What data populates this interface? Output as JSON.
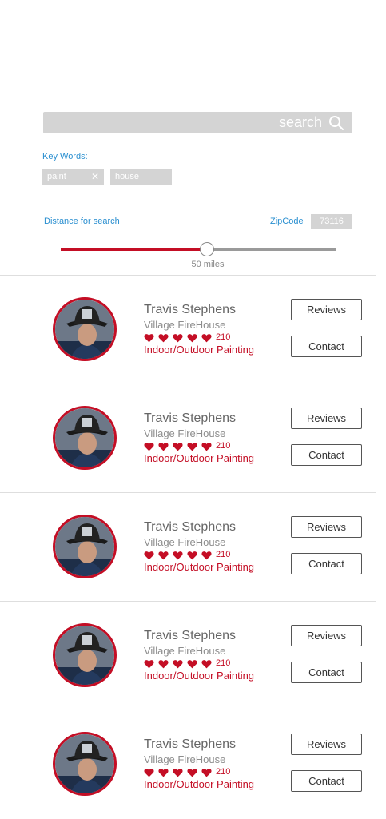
{
  "search": {
    "placeholder": "search"
  },
  "keywords": {
    "label": "Key Words:",
    "tags": [
      {
        "text": "paint",
        "removable": true
      },
      {
        "text": "house",
        "removable": false
      }
    ]
  },
  "distance": {
    "label": "Distance for search",
    "value_text": "50 miles",
    "slider_fraction": 0.53
  },
  "zip": {
    "label": "ZipCode",
    "value": "73116"
  },
  "colors": {
    "accent": "#c40e25",
    "link": "#2a8fd0",
    "field": "#d4d4d4"
  },
  "results": [
    {
      "name": "Travis Stephens",
      "station": "Village FireHouse",
      "hearts": 5,
      "rating_count": "210",
      "service": "Indoor/Outdoor Painting",
      "reviews_label": "Reviews",
      "contact_label": "Contact"
    },
    {
      "name": "Travis Stephens",
      "station": "Village FireHouse",
      "hearts": 5,
      "rating_count": "210",
      "service": "Indoor/Outdoor Painting",
      "reviews_label": "Reviews",
      "contact_label": "Contact"
    },
    {
      "name": "Travis Stephens",
      "station": "Village FireHouse",
      "hearts": 5,
      "rating_count": "210",
      "service": "Indoor/Outdoor Painting",
      "reviews_label": "Reviews",
      "contact_label": "Contact"
    },
    {
      "name": "Travis Stephens",
      "station": "Village FireHouse",
      "hearts": 5,
      "rating_count": "210",
      "service": "Indoor/Outdoor Painting",
      "reviews_label": "Reviews",
      "contact_label": "Contact"
    },
    {
      "name": "Travis Stephens",
      "station": "Village FireHouse",
      "hearts": 5,
      "rating_count": "210",
      "service": "Indoor/Outdoor Painting",
      "reviews_label": "Reviews",
      "contact_label": "Contact"
    }
  ]
}
